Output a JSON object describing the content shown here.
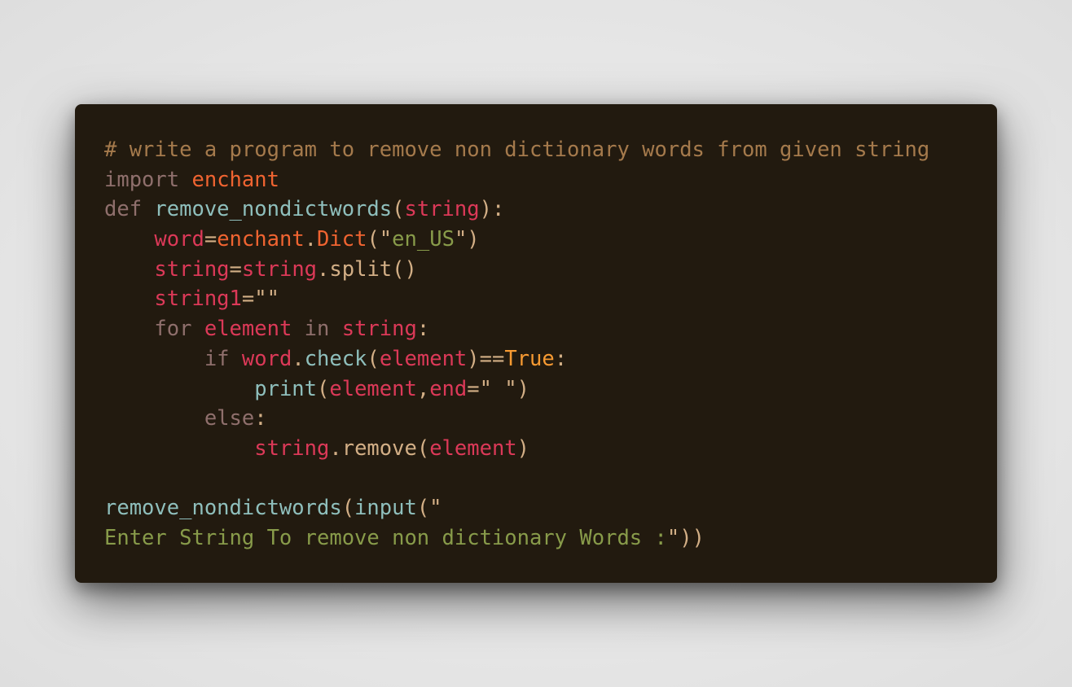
{
  "colors": {
    "window_bg": "#221a0f",
    "page_bg": "#e6e6e6",
    "comment": "#a57a4c",
    "keyword": "#8f6f6c",
    "module": "#f06431",
    "function": "#8fbfbc",
    "variable": "#dc3958",
    "string": "#889b4a",
    "constant": "#f79a32",
    "default": "#d3af86"
  },
  "code": {
    "lines": [
      {
        "tokens": [
          {
            "text": "# write a program to remove non dictionary words from given string",
            "kind": "comment"
          }
        ]
      },
      {
        "tokens": [
          {
            "text": "import",
            "kind": "keyword"
          },
          {
            "text": " ",
            "kind": "default"
          },
          {
            "text": "enchant",
            "kind": "module"
          }
        ]
      },
      {
        "tokens": [
          {
            "text": "def",
            "kind": "keyword"
          },
          {
            "text": " ",
            "kind": "default"
          },
          {
            "text": "remove_nondictwords",
            "kind": "function"
          },
          {
            "text": "(",
            "kind": "default"
          },
          {
            "text": "string",
            "kind": "variable"
          },
          {
            "text": "):",
            "kind": "default"
          }
        ]
      },
      {
        "tokens": [
          {
            "text": "    ",
            "kind": "default"
          },
          {
            "text": "word",
            "kind": "variable"
          },
          {
            "text": "=",
            "kind": "default"
          },
          {
            "text": "enchant",
            "kind": "module"
          },
          {
            "text": ".",
            "kind": "default"
          },
          {
            "text": "Dict",
            "kind": "module"
          },
          {
            "text": "(\"",
            "kind": "default"
          },
          {
            "text": "en_US",
            "kind": "string"
          },
          {
            "text": "\")",
            "kind": "default"
          }
        ]
      },
      {
        "tokens": [
          {
            "text": "    ",
            "kind": "default"
          },
          {
            "text": "string",
            "kind": "variable"
          },
          {
            "text": "=",
            "kind": "default"
          },
          {
            "text": "string",
            "kind": "variable"
          },
          {
            "text": ".split()",
            "kind": "default"
          }
        ]
      },
      {
        "tokens": [
          {
            "text": "    ",
            "kind": "default"
          },
          {
            "text": "string1",
            "kind": "variable"
          },
          {
            "text": "=\"\"",
            "kind": "default"
          }
        ]
      },
      {
        "tokens": [
          {
            "text": "    ",
            "kind": "default"
          },
          {
            "text": "for",
            "kind": "keyword"
          },
          {
            "text": " ",
            "kind": "default"
          },
          {
            "text": "element",
            "kind": "variable"
          },
          {
            "text": " ",
            "kind": "default"
          },
          {
            "text": "in",
            "kind": "keyword"
          },
          {
            "text": " ",
            "kind": "default"
          },
          {
            "text": "string",
            "kind": "variable"
          },
          {
            "text": ":",
            "kind": "default"
          }
        ]
      },
      {
        "tokens": [
          {
            "text": "        ",
            "kind": "default"
          },
          {
            "text": "if",
            "kind": "keyword"
          },
          {
            "text": " ",
            "kind": "default"
          },
          {
            "text": "word",
            "kind": "variable"
          },
          {
            "text": ".",
            "kind": "default"
          },
          {
            "text": "check",
            "kind": "function"
          },
          {
            "text": "(",
            "kind": "default"
          },
          {
            "text": "element",
            "kind": "variable"
          },
          {
            "text": ")==",
            "kind": "default"
          },
          {
            "text": "True",
            "kind": "constant"
          },
          {
            "text": ":",
            "kind": "default"
          }
        ]
      },
      {
        "tokens": [
          {
            "text": "            ",
            "kind": "default"
          },
          {
            "text": "print",
            "kind": "function"
          },
          {
            "text": "(",
            "kind": "default"
          },
          {
            "text": "element",
            "kind": "variable"
          },
          {
            "text": ",",
            "kind": "default"
          },
          {
            "text": "end",
            "kind": "variable"
          },
          {
            "text": "=\" \")",
            "kind": "default"
          }
        ]
      },
      {
        "tokens": [
          {
            "text": "        ",
            "kind": "default"
          },
          {
            "text": "else",
            "kind": "keyword"
          },
          {
            "text": ":",
            "kind": "default"
          }
        ]
      },
      {
        "tokens": [
          {
            "text": "            ",
            "kind": "default"
          },
          {
            "text": "string",
            "kind": "variable"
          },
          {
            "text": ".remove(",
            "kind": "default"
          },
          {
            "text": "element",
            "kind": "variable"
          },
          {
            "text": ")",
            "kind": "default"
          }
        ]
      },
      {
        "tokens": [
          {
            "text": "",
            "kind": "default"
          }
        ]
      },
      {
        "tokens": [
          {
            "text": "remove_nondictwords",
            "kind": "function"
          },
          {
            "text": "(",
            "kind": "default"
          },
          {
            "text": "input",
            "kind": "function"
          },
          {
            "text": "(\"",
            "kind": "default"
          }
        ]
      },
      {
        "tokens": [
          {
            "text": "Enter String To remove non dictionary Words :",
            "kind": "string"
          },
          {
            "text": "\"))",
            "kind": "default"
          }
        ]
      }
    ]
  }
}
